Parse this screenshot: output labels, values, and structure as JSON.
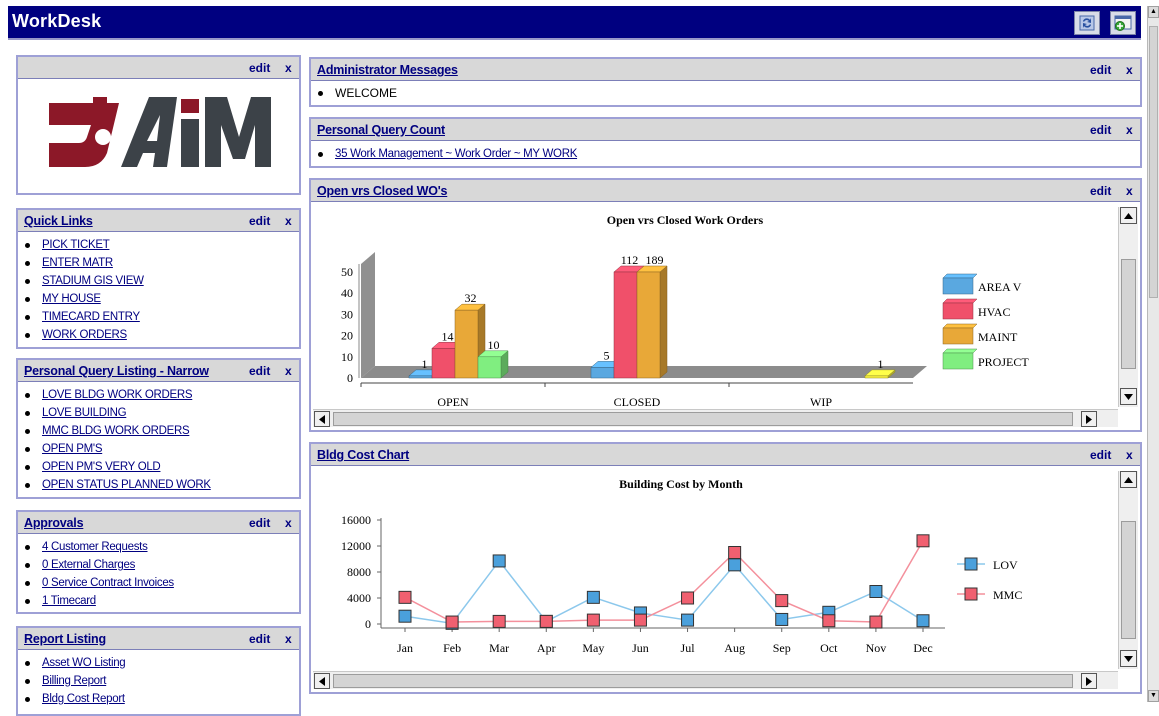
{
  "app": {
    "title": "WorkDesk"
  },
  "common": {
    "edit_label": "edit",
    "close_label": "x"
  },
  "logo": {
    "text": "AiM"
  },
  "quick_links": {
    "title": "Quick Links",
    "items": [
      "PICK TICKET",
      "ENTER MATR",
      "STADIUM GIS VIEW",
      "MY HOUSE",
      "TIMECARD ENTRY",
      "WORK ORDERS"
    ]
  },
  "query_listing": {
    "title": "Personal Query Listing - Narrow",
    "items": [
      "LOVE BLDG WORK ORDERS",
      "LOVE BUILDING",
      "MMC BLDG WORK ORDERS",
      "OPEN PM'S",
      "OPEN PM'S VERY OLD",
      "OPEN STATUS PLANNED WORK"
    ]
  },
  "approvals": {
    "title": "Approvals",
    "items": [
      "4 Customer Requests",
      "0 External Charges",
      "0 Service Contract Invoices",
      "1 Timecard"
    ]
  },
  "report_listing": {
    "title": "Report Listing",
    "items": [
      "Asset WO Listing",
      "Billing Report",
      "Bldg Cost Report"
    ]
  },
  "admin_messages": {
    "title": "Administrator Messages",
    "items": [
      "WELCOME"
    ]
  },
  "query_count": {
    "title": "Personal Query Count",
    "items": [
      "35 Work Management ~ Work Order ~ MY WORK"
    ]
  },
  "open_closed": {
    "title": "Open vrs Closed WO's"
  },
  "bldg_cost": {
    "title": "Bldg Cost Chart"
  },
  "colors": {
    "navy": "#000080",
    "area_v": "#5aa8e0",
    "hvac": "#f0506a",
    "maint": "#e8a838",
    "project": "#80ee80",
    "wip_bar": "#f8f040",
    "lov": "#4aa0dc",
    "mmc": "#f06070"
  },
  "chart_data": [
    {
      "type": "bar",
      "title": "Open vrs Closed Work Orders",
      "categories": [
        "OPEN",
        "CLOSED",
        "WIP"
      ],
      "ylim": [
        0,
        50
      ],
      "yticks": [
        0,
        10,
        20,
        30,
        40,
        50
      ],
      "series": [
        {
          "name": "AREA V",
          "values": [
            1,
            5,
            null
          ]
        },
        {
          "name": "HVAC",
          "values": [
            14,
            112,
            null
          ]
        },
        {
          "name": "MAINT",
          "values": [
            32,
            189,
            1
          ]
        },
        {
          "name": "PROJECT",
          "values": [
            10,
            null,
            null
          ]
        }
      ],
      "legend_position": "right"
    },
    {
      "type": "line",
      "title": "Building Cost by Month",
      "categories": [
        "Jan",
        "Feb",
        "Mar",
        "Apr",
        "May",
        "Jun",
        "Jul",
        "Aug",
        "Sep",
        "Oct",
        "Nov",
        "Dec"
      ],
      "ylim": [
        0,
        16000
      ],
      "yticks": [
        0,
        4000,
        8000,
        12000,
        16000
      ],
      "series": [
        {
          "name": "LOV",
          "values": [
            1200,
            100,
            9700,
            400,
            4100,
            1700,
            600,
            9100,
            700,
            1800,
            5000,
            500
          ]
        },
        {
          "name": "MMC",
          "values": [
            4100,
            300,
            400,
            400,
            600,
            600,
            4000,
            11000,
            3600,
            500,
            300,
            12800
          ]
        }
      ],
      "legend_position": "right"
    }
  ]
}
